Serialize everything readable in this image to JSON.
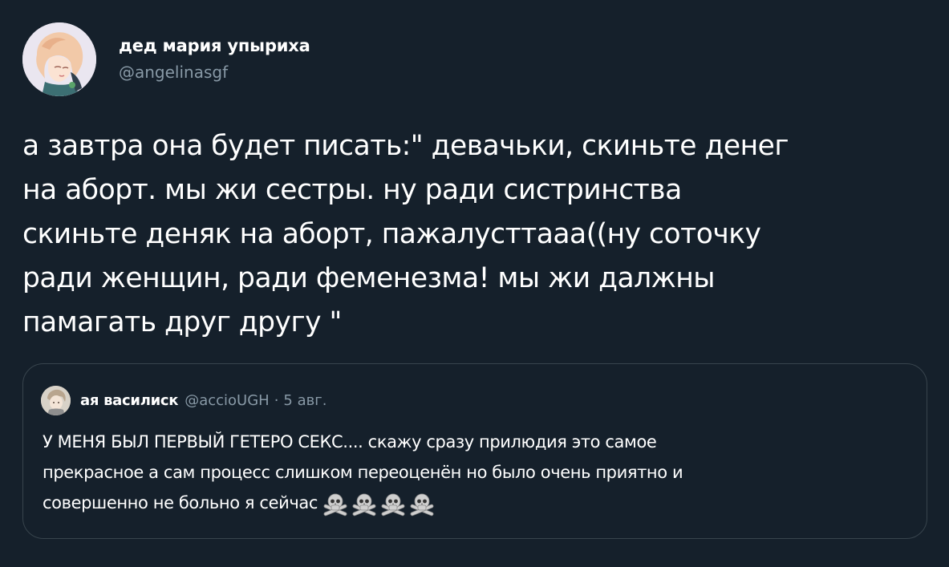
{
  "tweet": {
    "author": {
      "display_name": "дед мария упыриха",
      "handle": "@angelinasgf"
    },
    "text": "а завтра она будет писать:\" девачьки, скиньте денег\nна аборт. мы жи сестры. ну ради систринства\nскиньте деняк на аборт, пажалусттааа((ну соточку\nради женщин, ради феменезма! мы жи далжны\nпамагать друг другу \""
  },
  "quoted_tweet": {
    "author": {
      "display_name": "ая василиск",
      "handle": "@accioUGH"
    },
    "separator": "·",
    "date": "5 авг.",
    "text": "У МЕНЯ БЫЛ ПЕРВЫЙ ГЕТЕРО СЕКС.... скажу сразу прилюдия это самое\nпрекрасное а сам процесс слишком переоценён но было очень приятно и\nсовершенно не больно я сейчас",
    "emoji": [
      "skull-crossbones-icon",
      "skull-crossbones-icon",
      "skull-crossbones-icon",
      "skull-crossbones-icon"
    ]
  },
  "colors": {
    "background": "#15202b",
    "text_primary": "#ffffff",
    "text_secondary": "#8899a6",
    "border": "#38444d"
  }
}
